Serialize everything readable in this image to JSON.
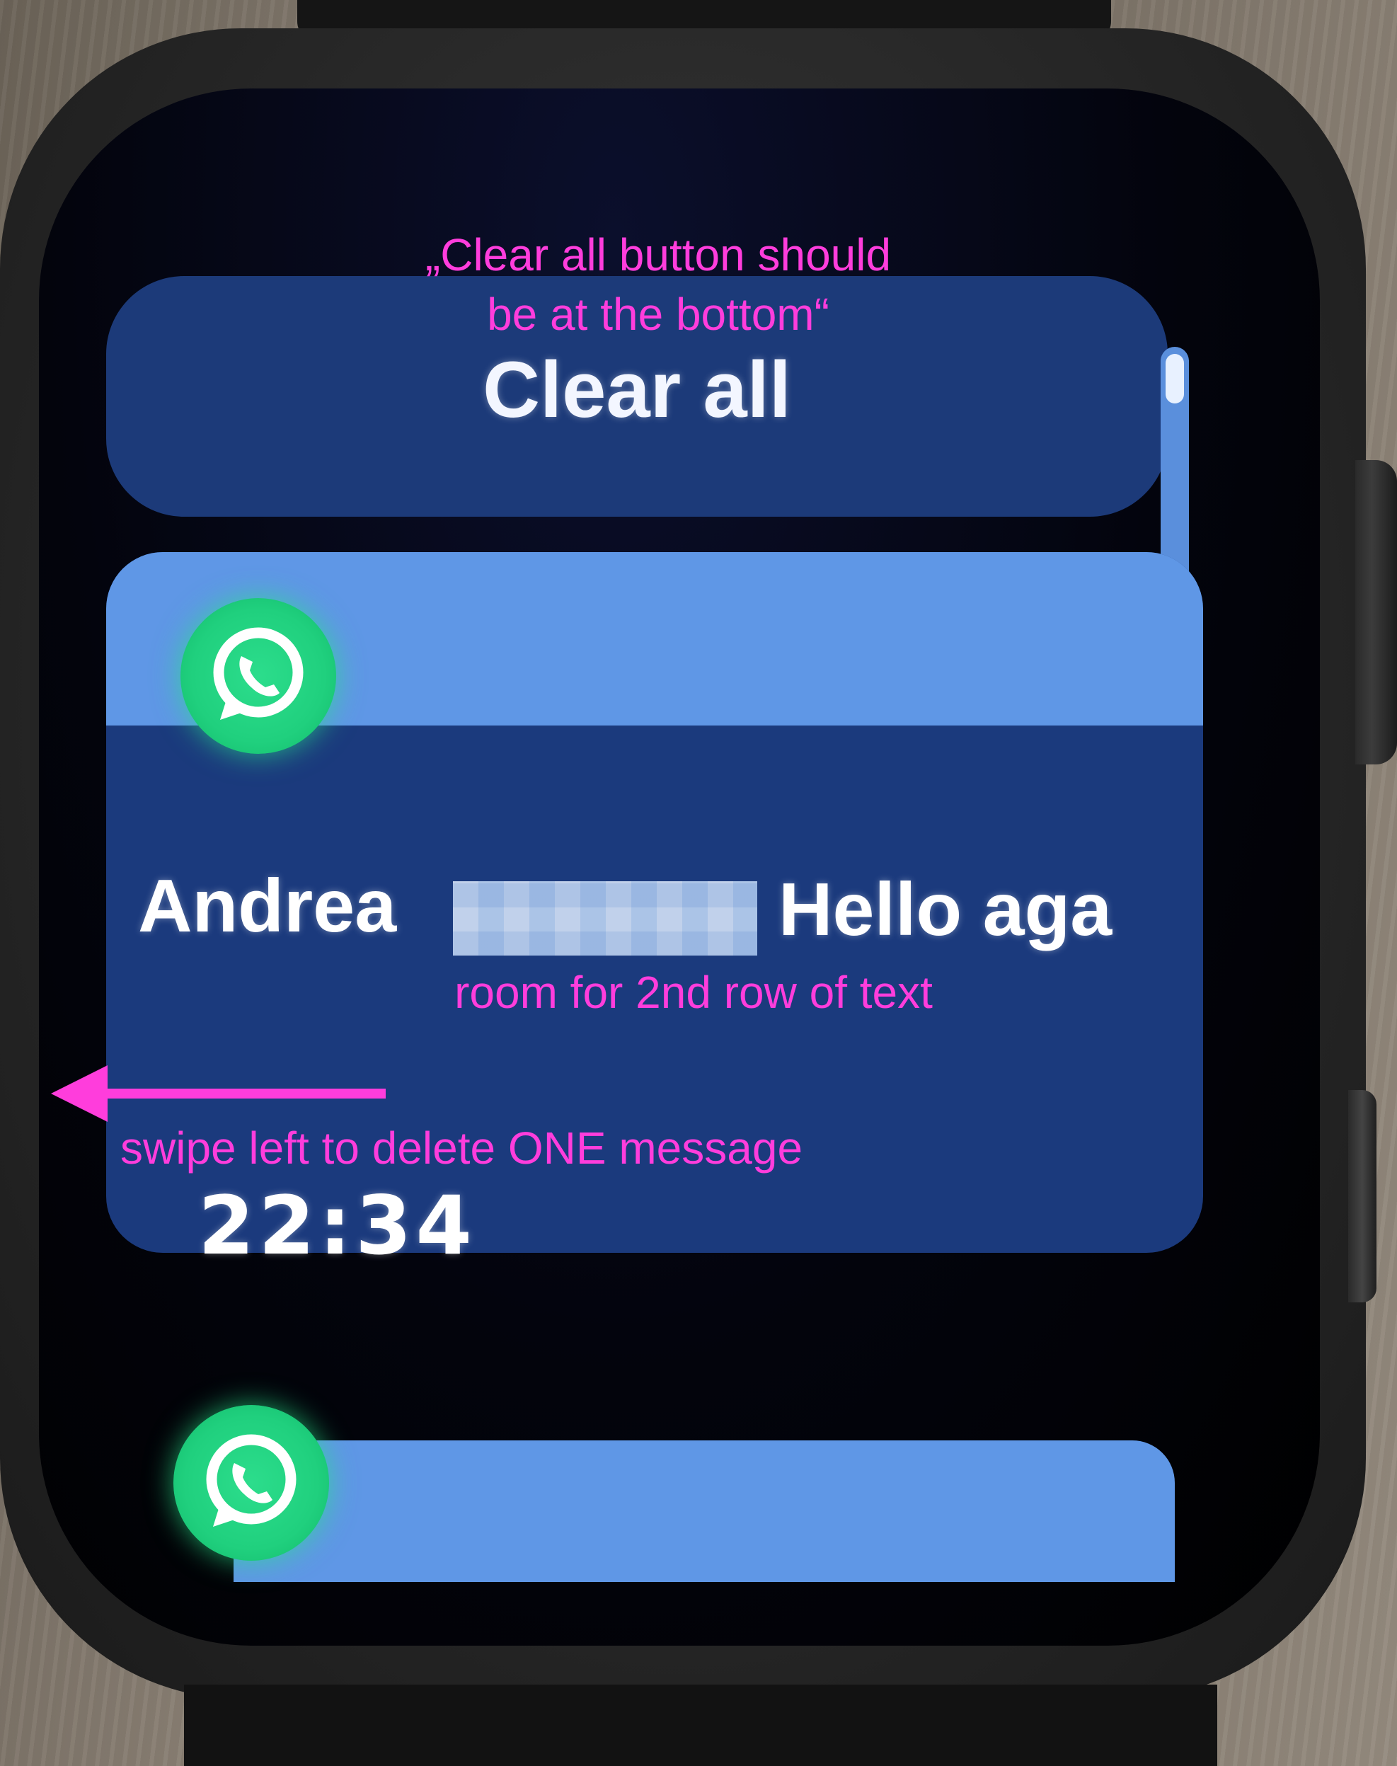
{
  "watch": {
    "clear_all_label": "Clear all",
    "notifications": [
      {
        "app": "WhatsApp",
        "icon": "whatsapp-icon",
        "sender": "Andrea",
        "preview": "Hello aga",
        "time": "22:34"
      },
      {
        "app": "WhatsApp",
        "icon": "whatsapp-icon"
      }
    ],
    "colors": {
      "clear_all_bg": "#1c3a79",
      "card_bg": "#1b3a7d",
      "card_header": "#5f97e6",
      "whatsapp_green": "#20d07e",
      "scrollbar": "#5a8fdc"
    }
  },
  "annotations": {
    "top_note": "„Clear all button should be at the bottom“",
    "room_note": "room for 2nd row of text",
    "swipe_note": "swipe left to delete ONE message",
    "color": "#ff3ddc"
  }
}
